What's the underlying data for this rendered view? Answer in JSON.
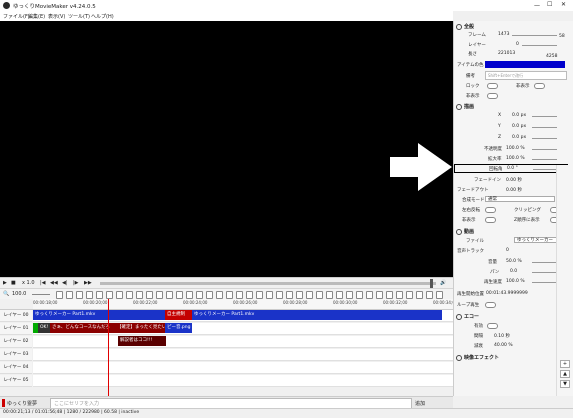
{
  "window": {
    "title": "ゆっくりMovieMaker v4.24.0.5"
  },
  "menu": [
    "ファイル(F)",
    "編集(E)",
    "表示(V)",
    "ツール(T)",
    "ヘルプ(H)"
  ],
  "playbar": {
    "loop_icon": "loop-icon",
    "speed": "x 1.0",
    "zoom": "100.0"
  },
  "ruler": {
    "ticks": [
      "00:00:18;00",
      "00:00:20;00",
      "00:00:22;00",
      "00:00:24;00",
      "00:00:26;00",
      "00:00:28;00",
      "00:00:30;00",
      "00:00:32;00",
      "00:00:34;0"
    ]
  },
  "timeline": {
    "layers": [
      "レイヤー 00",
      "レイヤー 01",
      "レイヤー 02",
      "レイヤー 03",
      "レイヤー 04",
      "レイヤー 05"
    ],
    "clips": {
      "l0a": "ゆっくりメーカー Part1.mkv",
      "l0b": "自主規制",
      "l0c": "ゆっくりメーカー Part1.mkv",
      "l1a": "OK!",
      "l1b": "さぁ、どんなコースなんだろ",
      "l1c": "【確定】まったく見たい",
      "l1d": "ピー音.png",
      "l2a": "解説者はココ!!!"
    }
  },
  "status": {
    "left_label": "ゆっくり霊夢",
    "input_placeholder": "ここにセリフを入力",
    "add_button": "追加",
    "info": "00:00:21;13 / 01:01:56;48 | 1280 / 222980 | 60.58 | inactive"
  },
  "props": {
    "sec_general": "全般",
    "frame_label": "フレーム",
    "frame_value": "1473",
    "frame_max": "58",
    "layer_label": "レイヤー",
    "layer_value": "0",
    "length_label": "長さ",
    "length_value": "221013",
    "length_max": "4258",
    "color_label": "アイテムの色",
    "color_value": "#0000cc",
    "memo_label": "備考",
    "memo_placeholder": "Shift+Enterで改行",
    "lock_label": "ロック",
    "hidden_label": "非表示",
    "other_label": "非表示",
    "sec_draw": "描画",
    "x_label": "X",
    "x_value": "0.0 px",
    "y_label": "Y",
    "y_value": "0.0 px",
    "z_label": "Z",
    "z_value": "0.0 px",
    "opacity_label": "不透明度",
    "opacity_value": "100.0 %",
    "scale_label": "拡大率",
    "scale_value": "100.0 %",
    "rotation_label": "回転角",
    "rotation_value": "0.0 °",
    "fadein_label": "フェードイン",
    "fadein_value": "0.00 秒",
    "fadeout_label": "フェードアウト",
    "fadeout_value": "0.00 秒",
    "blend_label": "合成モード",
    "blend_value": "通常",
    "invert_label": "左右反転",
    "clip_label": "クリッピング",
    "zorder_label": "非表示",
    "zorder2_label": "Z順序に表示",
    "sec_video": "動画",
    "file_label": "ファイル",
    "file_value": "ゆっくりメーカー",
    "track_label": "音声トラック",
    "track_value": "0",
    "volume_label": "音量",
    "volume_value": "50.0 %",
    "pan_label": "パン",
    "pan_value": "0.0",
    "speed_label": "再生速度",
    "speed_value": "100.0 %",
    "startpos_label": "再生開始位置",
    "startpos_value": "00:01:43.9999999",
    "loop_label": "ループ再生",
    "sec_echo": "エコー",
    "echo_valid_label": "有効",
    "interval_label": "間隔",
    "interval_value": "0.10 秒",
    "decay_label": "減衰",
    "decay_value": "40.00 %",
    "sec_effects": "映像エフェクト"
  }
}
